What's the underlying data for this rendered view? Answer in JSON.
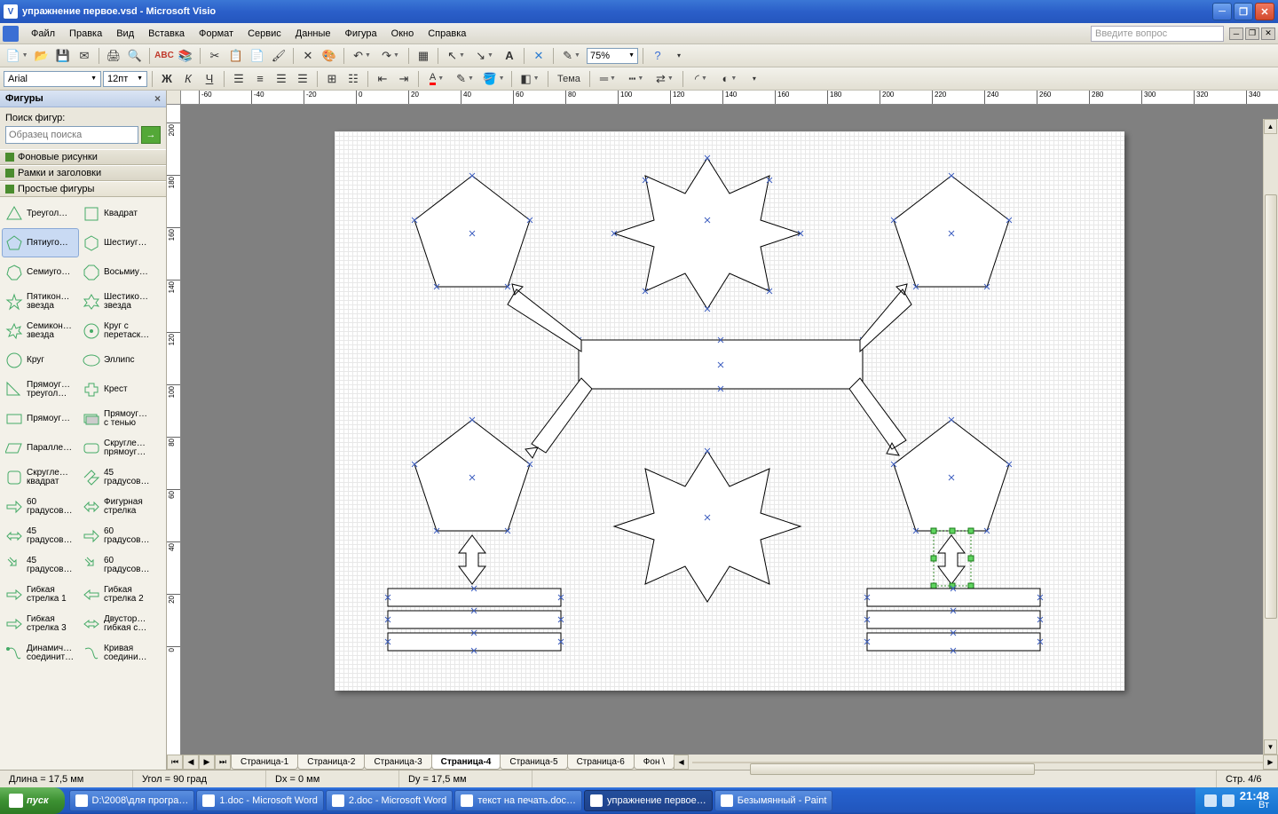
{
  "title": "упражнение первое.vsd - Microsoft Visio",
  "menu": [
    "Файл",
    "Правка",
    "Вид",
    "Вставка",
    "Формат",
    "Сервис",
    "Данные",
    "Фигура",
    "Окно",
    "Справка"
  ],
  "help_placeholder": "Введите вопрос",
  "zoom": "75%",
  "font_name": "Arial",
  "font_size": "12пт",
  "theme_label": "Тема",
  "sidebar": {
    "title": "Фигуры",
    "search_label": "Поиск фигур:",
    "search_placeholder": "Образец поиска",
    "categories": [
      "Фоновые рисунки",
      "Рамки и заголовки",
      "Простые фигуры"
    ],
    "shapes": [
      [
        "Треугол…",
        "Квадрат"
      ],
      [
        "Пятиуго…",
        "Шестиуг…"
      ],
      [
        "Семиуго…",
        "Восьмиу…"
      ],
      [
        "Пятикон… звезда",
        "Шестико… звезда"
      ],
      [
        "Семикон… звезда",
        "Круг с перетаск…"
      ],
      [
        "Круг",
        "Эллипс"
      ],
      [
        "Прямоуг… треугол…",
        "Крест"
      ],
      [
        "Прямоуг…",
        "Прямоуг… с тенью"
      ],
      [
        "Паралле…",
        "Скругле… прямоуг…"
      ],
      [
        "Скругле… квадрат",
        "45 градусов…"
      ],
      [
        "60 градусов…",
        "Фигурная стрелка"
      ],
      [
        "45 градусов…",
        "60 градусов…"
      ],
      [
        "45 градусов…",
        "60 градусов…"
      ],
      [
        "Гибкая стрелка 1",
        "Гибкая стрелка 2"
      ],
      [
        "Гибкая стрелка 3",
        "Двустор… гибкая с…"
      ],
      [
        "Динамич… соединит…",
        "Кривая соедини…"
      ]
    ]
  },
  "ruler_marks": [
    -60,
    -40,
    -20,
    0,
    20,
    40,
    60,
    80,
    100,
    120,
    140,
    160,
    180,
    200,
    220,
    240,
    260,
    280,
    300,
    320,
    340
  ],
  "ruler_v_marks": [
    200,
    180,
    160,
    140,
    120,
    100,
    80,
    60,
    40,
    20,
    0
  ],
  "page_tabs": [
    "Страница-1",
    "Страница-2",
    "Страница-3",
    "Страница-4",
    "Страница-5",
    "Страница-6",
    "Фон \\"
  ],
  "active_tab": 3,
  "status": {
    "length": "Длина = 17,5 мм",
    "angle": "Угол = 90 град",
    "dx": "Dx = 0 мм",
    "dy": "Dy = 17,5 мм",
    "page": "Стр. 4/6"
  },
  "taskbar": {
    "start": "пуск",
    "items": [
      "D:\\2008\\для програ…",
      "1.doc - Microsoft Word",
      "2.doc - Microsoft Word",
      "текст на печать.doc…",
      "упражнение первое…",
      "Безымянный - Paint"
    ],
    "active": 4,
    "time": "21:48",
    "day": "Вт"
  }
}
